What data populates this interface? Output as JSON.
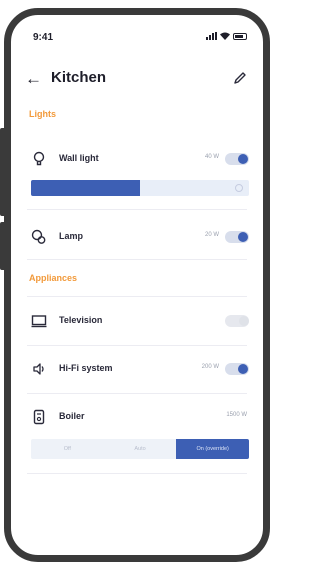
{
  "status": {
    "time": "9:41"
  },
  "header": {
    "title": "Kitchen",
    "back_label": "←"
  },
  "sections": {
    "lights": "Lights",
    "appliances": "Appliances"
  },
  "lights": {
    "wall_light": {
      "name": "Wall light",
      "value": "40 W",
      "on": true,
      "level": 0.5
    },
    "lamp": {
      "name": "Lamp",
      "value": "20 W",
      "on": true
    }
  },
  "appliances": {
    "television": {
      "name": "Television",
      "on": false
    },
    "hifi": {
      "name": "Hi-Fi system",
      "value": "200 W",
      "on": true
    },
    "boiler": {
      "name": "Boiler",
      "value": "1500 W",
      "modes": [
        "Off",
        "Auto",
        "On (override)"
      ],
      "selected": "On (override)"
    }
  },
  "colors": {
    "accent": "#3d5fb4",
    "section": "#f29a3b"
  },
  "icons": {
    "back": "arrow-left-icon",
    "edit": "pencil-icon",
    "wall_light": "light-bulb-icon",
    "lamp": "lamp-icon",
    "television": "tv-icon",
    "hifi": "speaker-icon",
    "boiler": "boiler-icon"
  }
}
